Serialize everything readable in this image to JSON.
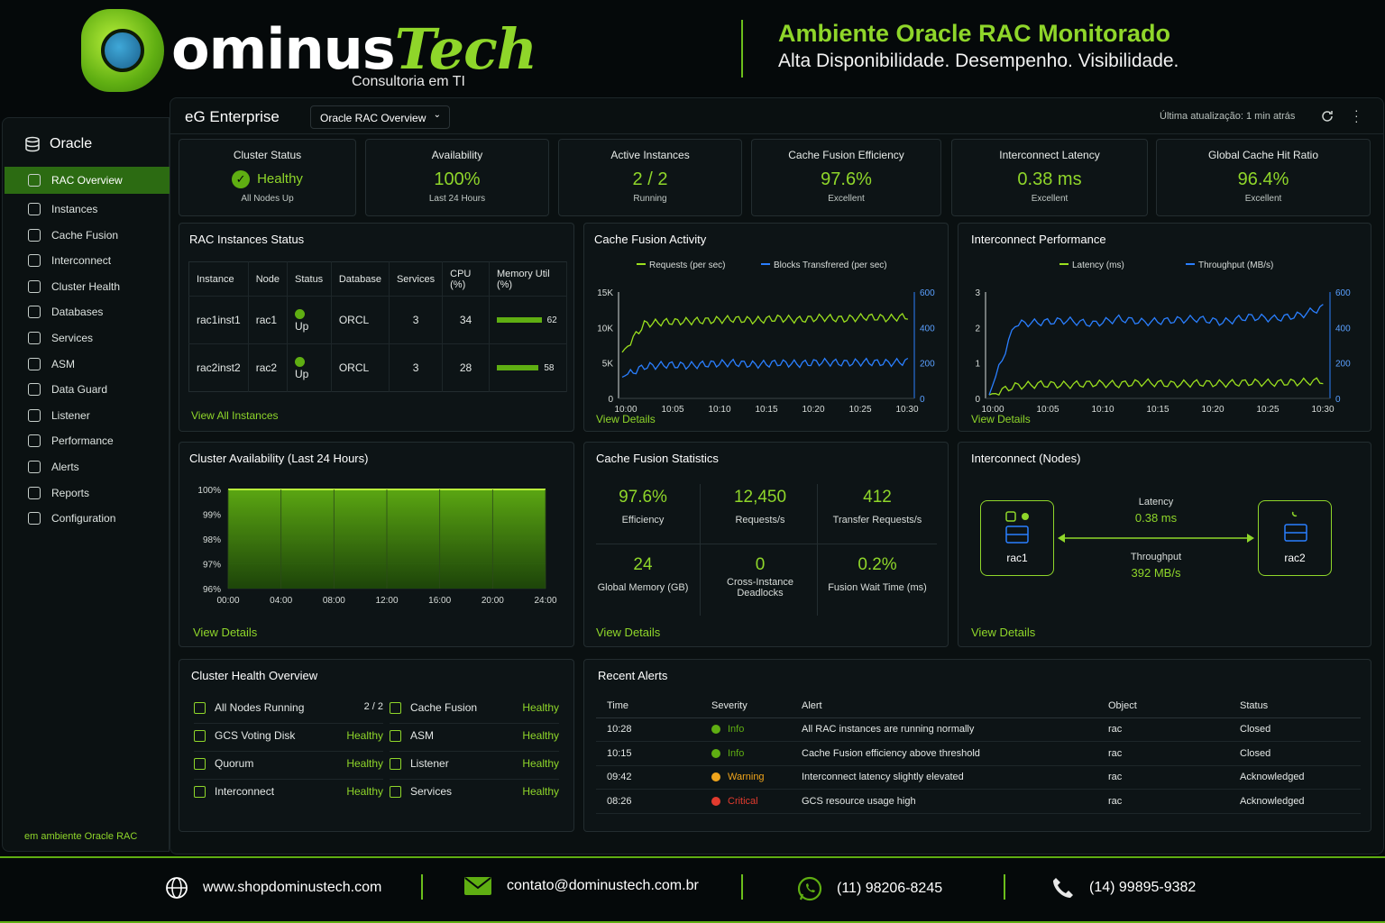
{
  "header": {
    "logo_prefix": "ominus",
    "logo_suffix": "Tech",
    "logo_sub": "Consultoria em TI",
    "headline": "Ambiente Oracle RAC Monitorado",
    "tagline": "Alta Disponibilidade. Desempenho. Visibilidade."
  },
  "sidebar": {
    "title": "Oracle",
    "items": [
      {
        "label": "RAC Overview",
        "icon": "overview-icon"
      },
      {
        "label": "Instances",
        "icon": "instances-icon"
      },
      {
        "label": "Cache Fusion",
        "icon": "cache-icon"
      },
      {
        "label": "Interconnect",
        "icon": "interconnect-icon"
      },
      {
        "label": "Cluster Health",
        "icon": "health-icon"
      },
      {
        "label": "Databases",
        "icon": "database-icon"
      },
      {
        "label": "Services",
        "icon": "services-icon"
      },
      {
        "label": "ASM",
        "icon": "asm-icon"
      },
      {
        "label": "Data Guard",
        "icon": "dataguard-icon"
      },
      {
        "label": "Listener",
        "icon": "listener-icon"
      },
      {
        "label": "Performance",
        "icon": "performance-icon"
      },
      {
        "label": "Alerts",
        "icon": "alert-icon"
      },
      {
        "label": "Reports",
        "icon": "reports-icon"
      },
      {
        "label": "Configuration",
        "icon": "gear-icon"
      }
    ],
    "footer": "em ambiente Oracle RAC"
  },
  "topbar": {
    "brand": "eG Enterprise",
    "view_select": "Oracle RAC Overview",
    "last_update": "Última atualização: 1 min atrás"
  },
  "kpis": [
    {
      "title": "Cluster Status",
      "value": "Healthy",
      "sub": "All Nodes Up"
    },
    {
      "title": "Availability",
      "value": "100%",
      "sub": "Last 24 Hours"
    },
    {
      "title": "Active Instances",
      "value": "2 / 2",
      "sub": "Running"
    },
    {
      "title": "Cache Fusion Efficiency",
      "value": "97.6%",
      "sub": "Excellent"
    },
    {
      "title": "Interconnect Latency",
      "value": "0.38 ms",
      "sub": "Excellent"
    },
    {
      "title": "Global Cache Hit Ratio",
      "value": "96.4%",
      "sub": "Excellent"
    }
  ],
  "instances": {
    "title": "RAC Instances Status",
    "columns": [
      "Instance",
      "Node",
      "Status",
      "Database",
      "Services",
      "CPU (%)",
      "Memory Util (%)"
    ],
    "rows": [
      {
        "instance": "rac1inst1",
        "node": "rac1",
        "status": "Up",
        "database": "ORCL",
        "services": "3",
        "cpu": "34",
        "mem": "62",
        "mem_fraction": 0.62
      },
      {
        "instance": "rac2inst2",
        "node": "rac2",
        "status": "Up",
        "database": "ORCL",
        "services": "3",
        "cpu": "28",
        "mem": "58",
        "mem_fraction": 0.58
      }
    ],
    "link": "View All Instances"
  },
  "cache_activity": {
    "title": "Cache Fusion Activity",
    "legend": [
      "Requests (per sec)",
      "Blocks Transfrered (per sec)"
    ],
    "link": "View Details"
  },
  "interconnect_perf": {
    "title": "Interconnect Performance",
    "legend": [
      "Latency (ms)",
      "Throughput (MB/s)"
    ],
    "link": "View Details"
  },
  "availability": {
    "title": "Cluster Availability (Last 24 Hours)",
    "link": "View Details"
  },
  "cache_stats": {
    "title": "Cache Fusion Statistics",
    "items": [
      {
        "value": "97.6%",
        "label": "Efficiency"
      },
      {
        "value": "12,450",
        "label": "Requests/s"
      },
      {
        "value": "412",
        "label": "Transfer Requests/s"
      },
      {
        "value": "24",
        "label": "Global Memory (GB)"
      },
      {
        "value": "0",
        "label": "Cross-Instance Deadlocks"
      },
      {
        "value": "0.2%",
        "label": "Fusion Wait Time (ms)"
      }
    ],
    "link": "View Details"
  },
  "interconnect_nodes": {
    "title": "Interconnect (Nodes)",
    "node1": "rac1",
    "node2": "rac2",
    "latency_label": "Latency",
    "latency_value": "0.38 ms",
    "throughput_label": "Throughput",
    "throughput_value": "392 MB/s",
    "link": "View Details"
  },
  "health": {
    "title": "Cluster Health Overview",
    "left": [
      {
        "label": "All Nodes Running",
        "value": "2 / 2"
      },
      {
        "label": "GCS Voting Disk",
        "value": "Healthy"
      },
      {
        "label": "Quorum",
        "value": "Healthy"
      },
      {
        "label": "Interconnect",
        "value": "Healthy"
      }
    ],
    "right": [
      {
        "label": "Cache Fusion",
        "value": "Healthy"
      },
      {
        "label": "ASM",
        "value": "Healthy"
      },
      {
        "label": "Listener",
        "value": "Healthy"
      },
      {
        "label": "Services",
        "value": "Healthy"
      }
    ]
  },
  "alerts": {
    "title": "Recent Alerts",
    "columns": [
      "Time",
      "Severity",
      "Alert",
      "Object",
      "Status"
    ],
    "rows": [
      {
        "time": "10:28",
        "severity": "Info",
        "alert": "All RAC instances are running normally",
        "object": "rac",
        "status": "Closed",
        "color": "#5fae12"
      },
      {
        "time": "10:15",
        "severity": "Info",
        "alert": "Cache Fusion efficiency above threshold",
        "object": "rac",
        "status": "Closed",
        "color": "#5fae12"
      },
      {
        "time": "09:42",
        "severity": "Warning",
        "alert": "Interconnect latency slightly elevated",
        "object": "rac",
        "status": "Acknowledged",
        "color": "#f0a51c"
      },
      {
        "time": "08:26",
        "severity": "Critical",
        "alert": "GCS resource usage high",
        "object": "rac",
        "status": "Acknowledged",
        "color": "#e23b2e"
      }
    ]
  },
  "footer": {
    "website": "www.shopdominustech.com",
    "email": "contato@dominustech.com.br",
    "whatsapp": "(11) 98206-8245",
    "phone": "(14) 99895-9382"
  },
  "chart_data": [
    {
      "type": "line",
      "title": "Cache Fusion Activity",
      "x": [
        "10:00",
        "10:05",
        "10:10",
        "10:15",
        "10:20",
        "10:25",
        "10:30"
      ],
      "y_left_ticks": [
        "0",
        "5K",
        "10K",
        "15K"
      ],
      "y_right_ticks": [
        "0",
        "200",
        "400",
        "600"
      ],
      "ylim_left": [
        0,
        15000
      ],
      "ylim_right": [
        0,
        600
      ],
      "series": [
        {
          "name": "Requests (per sec)",
          "axis": "left",
          "color": "#9be01e",
          "values": [
            6500,
            10500,
            10800,
            10900,
            11000,
            11200,
            11000,
            11300,
            11100,
            11400,
            11200,
            11500,
            11300,
            11600
          ]
        },
        {
          "name": "Blocks Transfrered (per sec)",
          "axis": "right",
          "color": "#2a7fff",
          "values": [
            120,
            180,
            190,
            185,
            195,
            200,
            190,
            200,
            195,
            205,
            200,
            205,
            200,
            210
          ]
        }
      ]
    },
    {
      "type": "line",
      "title": "Interconnect Performance",
      "x": [
        "10:00",
        "10:05",
        "10:10",
        "10:15",
        "10:20",
        "10:25",
        "10:30"
      ],
      "y_left_ticks": [
        "0",
        "1",
        "2",
        "3"
      ],
      "y_right_ticks": [
        "0",
        "200",
        "400",
        "600"
      ],
      "ylim_left": [
        0,
        3
      ],
      "ylim_right": [
        0,
        600
      ],
      "series": [
        {
          "name": "Latency (ms)",
          "axis": "left",
          "color": "#9be01e",
          "values": [
            0.1,
            0.35,
            0.4,
            0.38,
            0.42,
            0.4,
            0.45,
            0.4,
            0.43,
            0.42,
            0.45,
            0.44,
            0.46,
            0.5
          ]
        },
        {
          "name": "Throughput (MB/s)",
          "axis": "right",
          "color": "#2a7fff",
          "values": [
            20,
            420,
            430,
            440,
            420,
            450,
            430,
            440,
            450,
            430,
            460,
            450,
            470,
            520
          ]
        }
      ]
    },
    {
      "type": "area",
      "title": "Cluster Availability (Last 24 Hours)",
      "x": [
        "00:00",
        "04:00",
        "08:00",
        "12:00",
        "16:00",
        "20:00",
        "24:00"
      ],
      "y_ticks": [
        "96%",
        "97%",
        "98%",
        "99%",
        "100%"
      ],
      "ylim": [
        96,
        100
      ],
      "series": [
        {
          "name": "",
          "color": "#5fae12",
          "values": [
            100,
            100,
            100,
            100,
            100,
            100,
            100
          ]
        }
      ]
    }
  ]
}
